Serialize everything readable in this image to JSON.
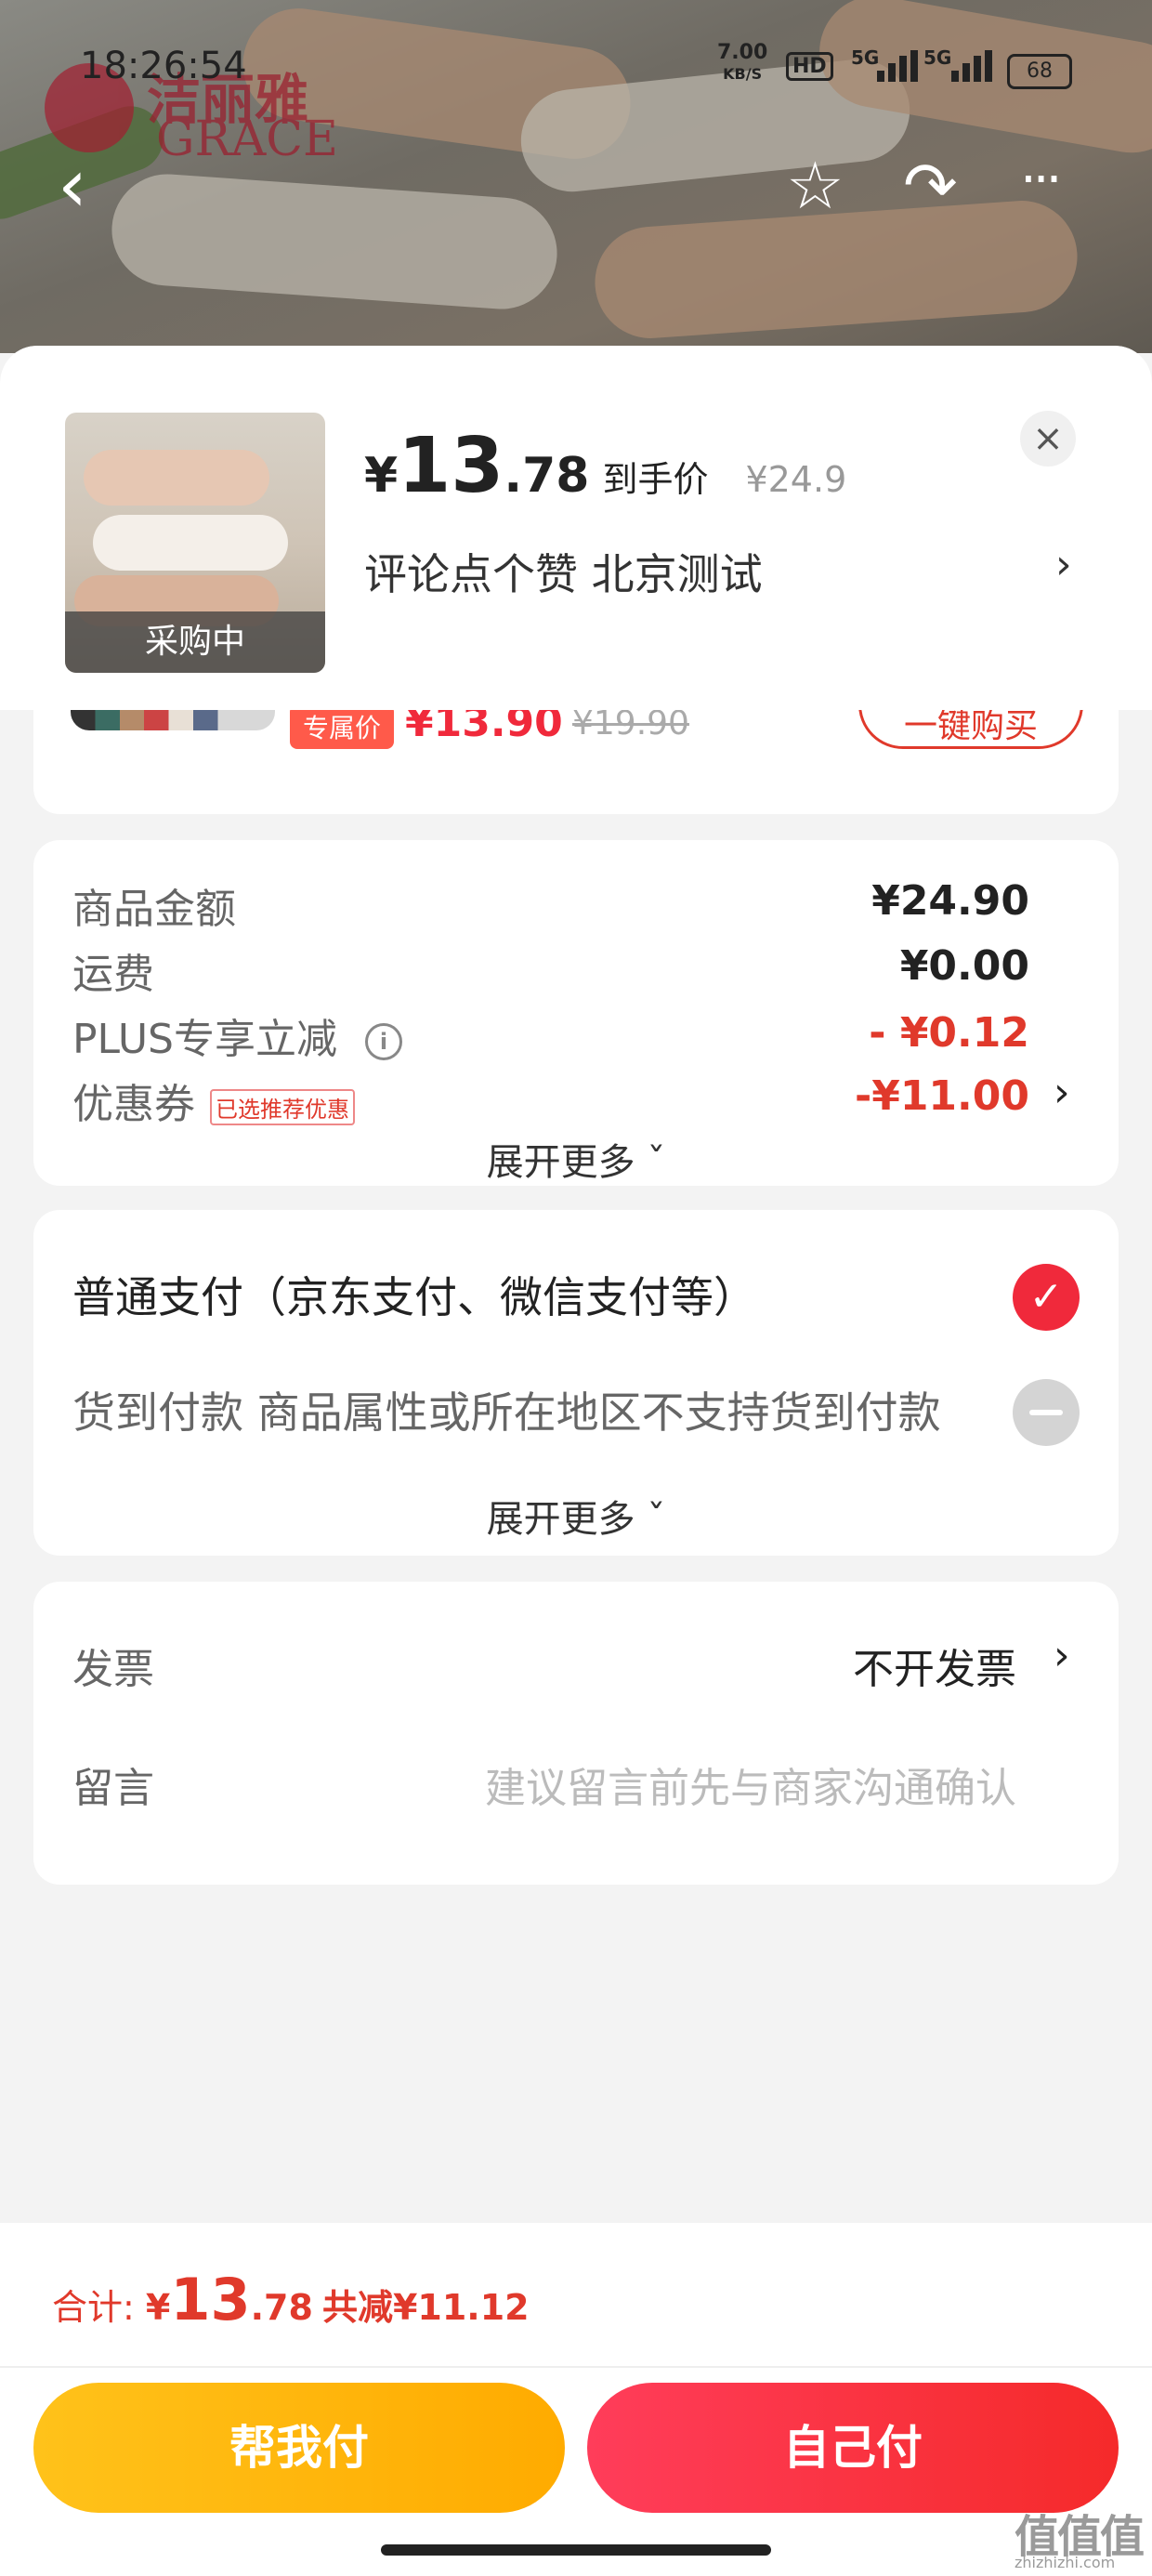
{
  "status_bar": {
    "time": "18:26:54",
    "net_speed": "7.00",
    "net_unit": "KB/S",
    "hd": "HD",
    "sig1": "5G",
    "sig2": "5G",
    "battery": "68"
  },
  "brand": {
    "cn": "洁丽雅",
    "en": "GRACE"
  },
  "nav": {
    "back": "‹",
    "favorite": "☆",
    "share": "↷",
    "more": "···"
  },
  "product": {
    "thumb_badge": "采购中",
    "price_symbol": "¥",
    "price_int": "13",
    "price_dec": ".78",
    "price_label": "到手价",
    "original_price": "¥24.9",
    "spec": "评论点个赞  北京测试",
    "spec_arrow": "›",
    "close": "×"
  },
  "peek": {
    "tag": "专属价",
    "price": "¥13.90",
    "original": "¥19.90",
    "button": "一键购买"
  },
  "summary": {
    "rows": [
      {
        "label": "商品金额",
        "value": "¥24.90"
      },
      {
        "label": "运费",
        "value": "¥0.00"
      },
      {
        "label": "PLUS专享立减",
        "value": "- ¥0.12",
        "info_icon": "i"
      },
      {
        "label": "优惠券",
        "tag": "已选推荐优惠",
        "value": "-¥11.00",
        "arrow": "›"
      }
    ],
    "more": "展开更多 ˇ"
  },
  "payment": {
    "options": [
      {
        "label": "普通支付（京东支付、微信支付等）",
        "selected": true,
        "check": "✓"
      },
      {
        "label": "货到付款 商品属性或所在地区不支持货到付款",
        "selected": false
      }
    ],
    "more": "展开更多 ˇ"
  },
  "extra": {
    "invoice_label": "发票",
    "invoice_value": "不开发票",
    "invoice_arrow": "›",
    "message_label": "留言",
    "message_placeholder": "建议留言前先与商家沟通确认"
  },
  "footer": {
    "total_label": "合计: ",
    "total_symbol": "¥",
    "total_int": "13",
    "total_dec": ".78",
    "saved": "共减¥11.12",
    "help_pay": "帮我付",
    "self_pay": "自己付"
  },
  "watermark": {
    "mark": "值值值",
    "url": "zhizhizhi.com"
  },
  "colors": {
    "accent": "#f0293b",
    "yellow": "#ffb300",
    "text": "#222222",
    "muted": "#666666"
  }
}
